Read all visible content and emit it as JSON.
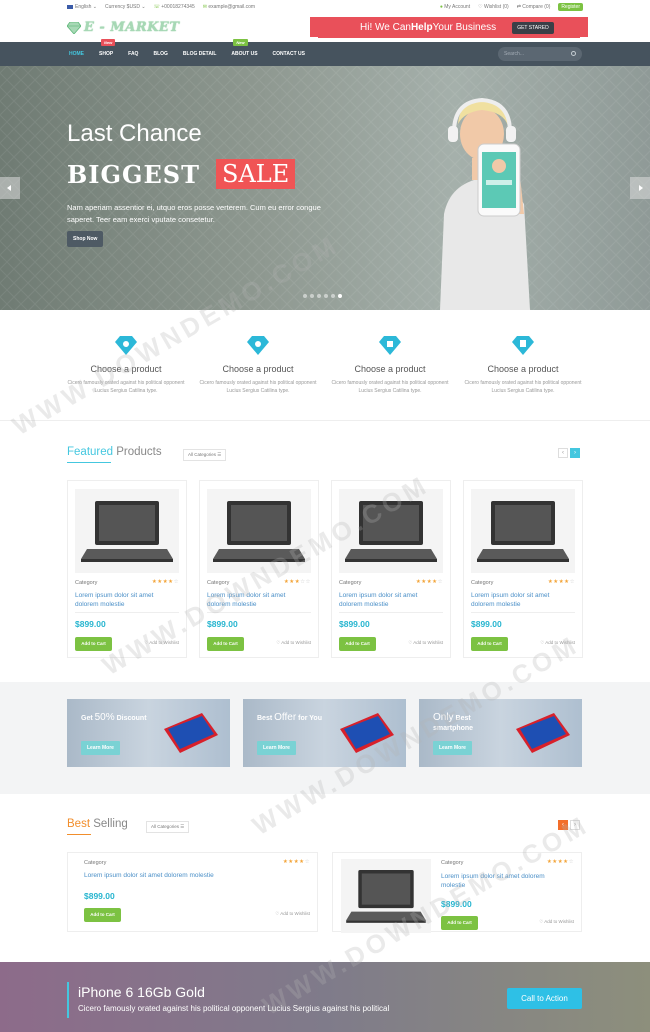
{
  "topbar": {
    "language": "English ⌄",
    "currency": "Currency $USD ⌄",
    "phone": "+00018274345",
    "email": "example@gmail.com",
    "account": "My Account",
    "wishlist": "Wishlist (0)",
    "compare": "Compare (0)",
    "register": "Register"
  },
  "logo": {
    "text": "E - MARKET"
  },
  "promo": {
    "prefix": "Hi! We Can ",
    "bold": "Help",
    "suffix": " Your Business",
    "button": "GET STARED"
  },
  "nav": {
    "items": [
      "HOME",
      "SHOP",
      "FAQ",
      "BLOG",
      "BLOG DETAIL",
      "ABOUT US",
      "CONTACT US"
    ],
    "badge_shop": "New",
    "badge_about": "New",
    "search_placeholder": "Search..."
  },
  "hero": {
    "line1": "Last Chance",
    "big": "BIGGEST",
    "sale": "SALE",
    "desc": "Nam aperiam assentior ei, utquo eros posse verterem. Cum eu error congue saperet. Teer eam exerci vputate consetetur.",
    "button": "Shop Now"
  },
  "features": [
    {
      "title": "Choose a product",
      "desc": "Cicero famously orated against his political opponent Lucius Sergius Catilina type."
    },
    {
      "title": "Choose a product",
      "desc": "Cicero famously orated against his political opponent Lucius Sergius Catilina type."
    },
    {
      "title": "Choose a product",
      "desc": "Cicero famously orated against his political opponent Lucius Sergius Catilina type."
    },
    {
      "title": "Choose a product",
      "desc": "Cicero famously orated against his political opponent Lucius Sergius Catilina type."
    }
  ],
  "featured": {
    "title_hl": "Featured",
    "title_rest": " Products",
    "category": "All Categories ☰"
  },
  "products": [
    {
      "category": "Category",
      "name": "Lorem ipsum dolor sit amet dolorem molestie",
      "price": "$899.00",
      "cart": "Add to Cart",
      "wish": "♡ Add to Wishlist"
    },
    {
      "category": "Category",
      "name": "Lorem ipsum dolor sit amet dolorem molestie",
      "price": "$899.00",
      "cart": "Add to Cart",
      "wish": "♡ Add to Wishlist"
    },
    {
      "category": "Category",
      "name": "Lorem ipsum dolor sit amet dolorem molestie",
      "price": "$899.00",
      "cart": "Add to Cart",
      "wish": "♡ Add to Wishlist"
    },
    {
      "category": "Category",
      "name": "Lorem ipsum dolor sit amet dolorem molestie",
      "price": "$899.00",
      "cart": "Add to Cart",
      "wish": "♡ Add to Wishlist"
    }
  ],
  "banners": [
    {
      "a": "Get ",
      "b": "50%",
      "c": " Discount",
      "button": "Learn More"
    },
    {
      "a": "Best ",
      "b": "Offer",
      "c": " for You",
      "button": "Learn More"
    },
    {
      "a": "",
      "b": "Only",
      "c": " Best smartphone",
      "button": "Learn More"
    }
  ],
  "bestselling": {
    "title_hl": "Best",
    "title_rest": " Selling",
    "category": "All Categories ☰",
    "items": [
      {
        "category": "Category",
        "name": "Lorem ipsum dolor sit amet dolorem molestie",
        "price": "$899.00",
        "cart": "Add to Cart",
        "wish": "♡ Add to Wishlist"
      },
      {
        "category": "Category",
        "name": "Lorem ipsum dolor sit amet dolorem molestie",
        "price": "$899.00",
        "cart": "Add to Cart",
        "wish": "♡ Add to Wishlist"
      }
    ]
  },
  "cta": {
    "title": "iPhone 6 16Gb Gold",
    "sub": "Cicero famously orated against his political opponent Lucius Sergius against his political",
    "button": "Call to Action"
  },
  "watermark": "WWW.DOWNDEMO.COM",
  "colors": {
    "accent": "#44c7df",
    "red": "#e9505a",
    "green": "#7cc242",
    "nav": "#46535e"
  }
}
